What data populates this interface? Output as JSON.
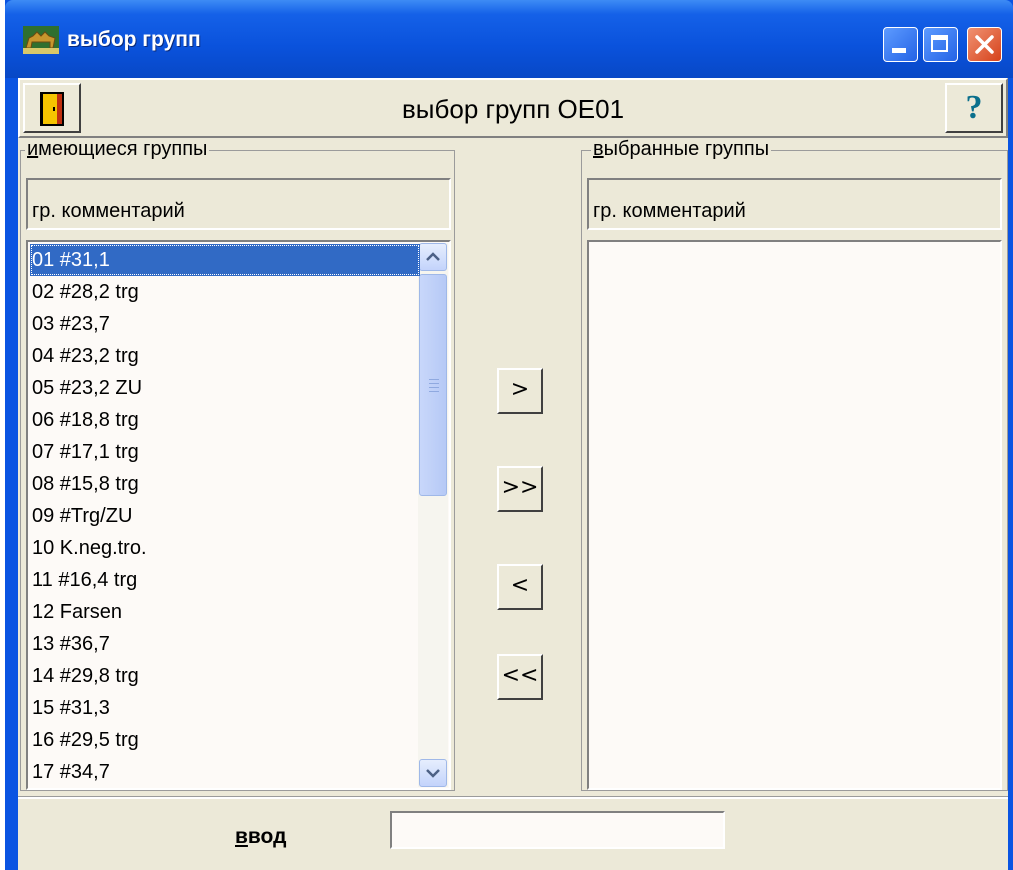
{
  "window": {
    "title": "выбор групп",
    "colors": {
      "titlebar": "#0a54e2",
      "face": "#ece9d8",
      "selection": "#316ac5"
    }
  },
  "header": {
    "title": "выбор групп ОЕ01",
    "exit_icon": "door-exit-icon",
    "help_label": "?"
  },
  "available": {
    "title_prefix": "и",
    "title_rest": "меющиеся группы",
    "column_header": "гр.  комментарий",
    "selected_index": 0,
    "items": [
      "01  #31,1",
      "02  #28,2 trg",
      "03  #23,7",
      "04  #23,2 trg",
      "05  #23,2 ZU",
      "06  #18,8 trg",
      "07  #17,1 trg",
      "08  #15,8 trg",
      "09  #Trg/ZU",
      "10  K.neg.tro.",
      "11  #16,4 trg",
      "12  Farsen",
      "13  #36,7",
      "14  #29,8 trg",
      "15  #31,3",
      "16  #29,5 trg",
      "17  #34,7"
    ]
  },
  "selected": {
    "title_prefix": "в",
    "title_rest": "ыбранные группы",
    "column_header": "гр.  комментарий",
    "items": []
  },
  "buttons": {
    "add_one": ">",
    "add_all": ">>",
    "remove_one": "<",
    "remove_all": "<<"
  },
  "input": {
    "label_prefix": "в",
    "label_rest": "вод",
    "value": ""
  }
}
